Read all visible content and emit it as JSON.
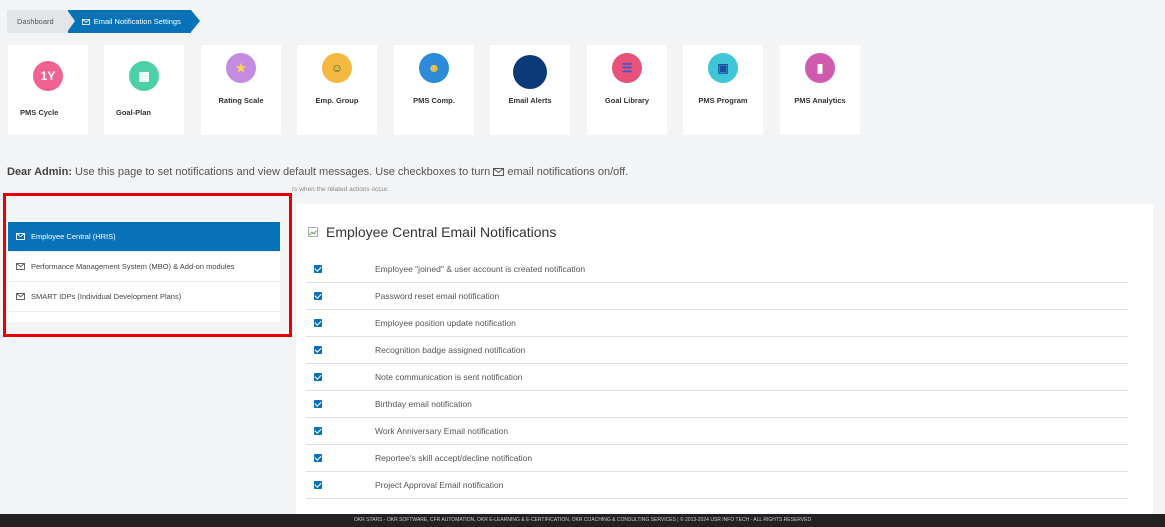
{
  "breadcrumb": {
    "home": "Dashboard",
    "current": "Email Notification Settings"
  },
  "tiles": [
    {
      "label": "PMS Cycle",
      "icon": "calendar-cycle-icon",
      "color": "#f06292",
      "glyph": "1Y"
    },
    {
      "label": "Goal-Plan",
      "icon": "calendar-plan-icon",
      "color": "#4dd0a8",
      "glyph": "▦"
    },
    {
      "label": "Rating Scale",
      "icon": "star-rating-icon",
      "color": "#c48be0",
      "glyph": "★"
    },
    {
      "label": "Emp. Group",
      "icon": "users-add-icon",
      "color": "#f5b942",
      "glyph": "☺"
    },
    {
      "label": "PMS Comp.",
      "icon": "head-gear-icon",
      "color": "#2e8bd8",
      "glyph": "☻"
    },
    {
      "label": "Email Alerts",
      "icon": "broken-image-icon",
      "color": "#0a3a78",
      "glyph": ""
    },
    {
      "label": "Goal Library",
      "icon": "list-add-icon",
      "color": "#e8527a",
      "glyph": "☰"
    },
    {
      "label": "PMS Program",
      "icon": "presentation-icon",
      "color": "#3ec6d6",
      "glyph": "▣"
    },
    {
      "label": "PMS Analytics",
      "icon": "report-chart-icon",
      "color": "#d05ab0",
      "glyph": "▮"
    }
  ],
  "intro": {
    "lead": "Dear Admin:",
    "text_before": " Use this page to set notifications and view default messages. Use checkboxes to turn ",
    "text_after": " email notifications on/off.",
    "subtext": "rs when the related actions occur."
  },
  "left_menu": [
    {
      "label": "Employee Central (HRIS)",
      "active": true
    },
    {
      "label": "Performance Management System (MBO) & Add-on modules",
      "active": false
    },
    {
      "label": "SMART IDPs (Individual Development Plans)",
      "active": false
    }
  ],
  "right": {
    "title": "Employee Central Email Notifications",
    "notifications": [
      {
        "label": "Employee \"joined\" & user account is created notification",
        "checked": true
      },
      {
        "label": "Password reset email notification",
        "checked": true
      },
      {
        "label": "Employee position update notification",
        "checked": true
      },
      {
        "label": "Recognition badge assigned notification",
        "checked": true
      },
      {
        "label": "Note communication is sent notification",
        "checked": true
      },
      {
        "label": "Birthday email notification",
        "checked": true
      },
      {
        "label": "Work Anniversary Email notification",
        "checked": true
      },
      {
        "label": "Reportee's skill accept/decline notification",
        "checked": true
      },
      {
        "label": "Project Approval Email notification",
        "checked": true
      }
    ]
  },
  "footer": "OKR STARS - OKR SOFTWARE, CFR AUTOMATION, OKR E-LEARNING & E-CERTIFICATION, OKR COACHING & CONSULTING SERVICES | © 2013-2024 USR INFO TECH - ALL RIGHTS RESERVED",
  "colors": {
    "accent": "#0872b8",
    "highlight": "#e60000"
  }
}
